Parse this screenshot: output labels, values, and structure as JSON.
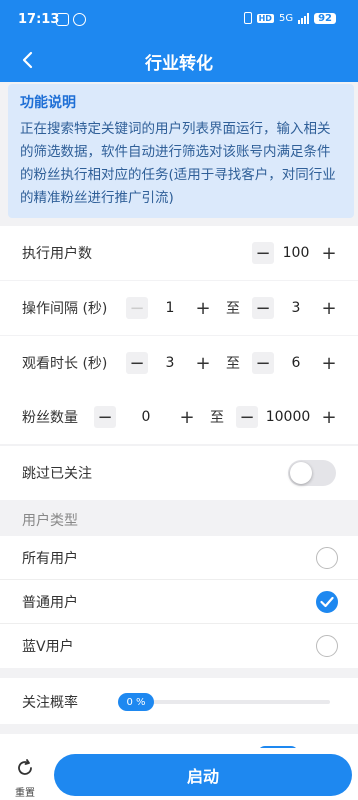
{
  "status_bar": {
    "time": "17:13",
    "hd": "HD",
    "network": "5G",
    "battery": "92"
  },
  "nav": {
    "title": "行业转化"
  },
  "info": {
    "heading": "功能说明",
    "text": "正在搜索特定关键词的用户列表界面运行，输入相关的筛选数据，软件自动进行筛选对该账号内满足条件的粉丝执行相对应的任务(适用于寻找客户，对同行业的精准粉丝进行推广引流)"
  },
  "settings": {
    "exec_users": {
      "label": "执行用户数",
      "value": "100"
    },
    "interval": {
      "label": "操作间隔 (秒)",
      "min": "1",
      "max": "3",
      "sep": "至"
    },
    "watch": {
      "label": "观看时长 (秒)",
      "min": "3",
      "max": "6",
      "sep": "至"
    },
    "fans": {
      "label": "粉丝数量",
      "min": "0",
      "max": "10000",
      "sep": "至"
    },
    "skip_followed": {
      "label": "跳过已关注",
      "enabled": false
    }
  },
  "user_type": {
    "title": "用户类型",
    "options": [
      {
        "label": "所有用户",
        "selected": false
      },
      {
        "label": "普通用户",
        "selected": true
      },
      {
        "label": "蓝V用户",
        "selected": false
      }
    ]
  },
  "follow_rate": {
    "label": "关注概率",
    "value_text": "0 %",
    "value": 0
  },
  "footer": {
    "reset_label": "重置",
    "start_label": "启动"
  },
  "colors": {
    "accent": "#1e88f0",
    "info_bg": "#dbe9fb"
  }
}
